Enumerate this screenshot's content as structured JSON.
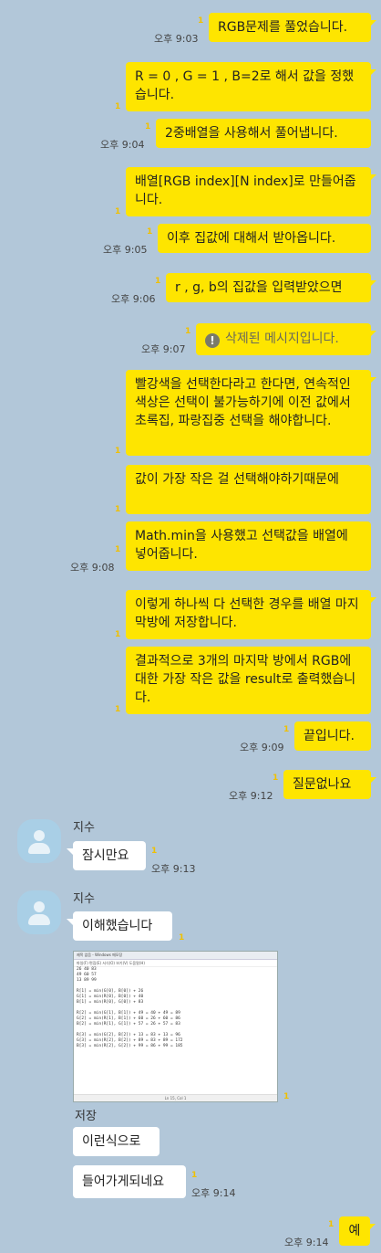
{
  "messages": [
    {
      "text": "RGB문제를 풀었습니다.",
      "time": "오후 9:03",
      "unread": "1"
    },
    {
      "text": "R = 0 , G = 1 , B=2로 해서 값을 정했습니다.",
      "unread": "1"
    },
    {
      "text": "2중배열을 사용해서 풀어냅니다.",
      "time": "오후 9:04",
      "unread": "1"
    },
    {
      "text": "배열[RGB index][N index]로 만들어줍니다.",
      "unread": "1"
    },
    {
      "text": "이후 집값에 대해서 받아옵니다.",
      "time": "오후 9:05",
      "unread": "1"
    },
    {
      "text": "r , g, b의 집값을 입력받았으면",
      "time": "오후 9:06",
      "unread": "1"
    },
    {
      "text": "삭제된 메시지입니다.",
      "time": "오후 9:07",
      "unread": "1"
    },
    {
      "text": "빨강색을 선택한다라고 한다면, 연속적인 색상은 선택이 불가능하기에 이전 값에서 초록집, 파랑집중 선택을 해야합니다.",
      "unread": "1"
    },
    {
      "text": "값이 가장 작은 걸 선택해야하기때문에",
      "unread": "1"
    },
    {
      "text": "Math.min을 사용했고 선택값을 배열에 넣어줍니다.",
      "time": "오후 9:08",
      "unread": "1"
    },
    {
      "text": "이렇게 하나씩 다 선택한 경우를 배열 마지막방에 저장합니다.",
      "unread": "1"
    },
    {
      "text": "결과적으로 3개의 마지막 방에서 RGB에 대한 가장 작은 값을 result로 출력했습니다.",
      "unread": "1"
    },
    {
      "text": "끝입니다.",
      "time": "오후 9:09",
      "unread": "1"
    },
    {
      "text": "질문없나요",
      "time": "오후 9:12",
      "unread": "1"
    },
    {
      "sender": "지수",
      "text": "잠시만요",
      "time": "오후 9:13",
      "unread": "1"
    },
    {
      "sender": "지수",
      "text": "이해했습니다",
      "unread": "1"
    },
    {
      "image_unread": "1",
      "save_label": "저장"
    },
    {
      "text": "이런식으로"
    },
    {
      "text": "들어가게되네요",
      "time": "오후 9:14",
      "unread": "1"
    },
    {
      "text": "예",
      "time": "오후 9:14",
      "unread": "1"
    }
  ],
  "screenshot": {
    "title": "제목 없음 - Windows 메모장",
    "menu": "파일(F)  편집(E)  서식(O)  보기(V)  도움말(H)",
    "lines": [
      "26 40 83",
      "49 60 57",
      "13 89 99",
      "",
      "R[1] = min(G[0], B[0]) + 26",
      "G[1] = min(R[0], B[0]) + 40",
      "B[1] = min(R[0], G[0]) + 83",
      "",
      "R[2] = min(G[1], B[1]) + 49 = 40 + 49 = 89",
      "G[2] = min(R[1], B[1]) + 60 = 26 + 60 = 86",
      "B[2] = min(R[1], G[1]) + 57 = 26 + 57 = 83",
      "",
      "R[3] = min(G[2], B[2]) + 13 = 83 + 13 = 96",
      "G[3] = min(R[2], B[2]) + 89 = 83 + 89 = 172",
      "B[3] = min(R[2], G[2]) + 99 = 86 + 99 = 185"
    ],
    "status": "Ln 15, Col 1"
  },
  "colors": {
    "background": "#b2c7d9",
    "my_bubble": "#fee500",
    "other_bubble": "#ffffff",
    "unread": "#f0c000"
  },
  "icons": {
    "deleted": "exclamation-circle-icon",
    "avatar": "person-avatar-icon"
  }
}
